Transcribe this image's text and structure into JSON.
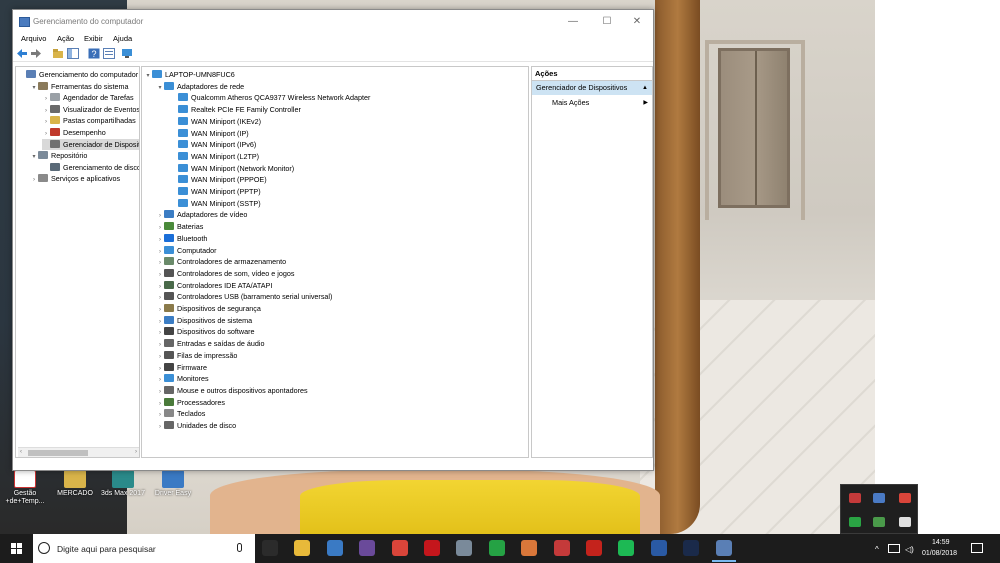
{
  "window": {
    "title": "Gerenciamento do computador",
    "controls": {
      "minimize": "—",
      "maximize": "☐",
      "close": "✕"
    }
  },
  "menu": [
    "Arquivo",
    "Ação",
    "Exibir",
    "Ajuda"
  ],
  "left_tree": [
    {
      "label": "Gerenciamento do computador",
      "level": 0,
      "expander": "",
      "icon_color": "#5a7fb5"
    },
    {
      "label": "Ferramentas do sistema",
      "level": 1,
      "expander": "▾",
      "icon_color": "#8a7a5a"
    },
    {
      "label": "Agendador de Tarefas",
      "level": 2,
      "expander": "›",
      "icon_color": "#9aa0a6"
    },
    {
      "label": "Visualizador de Eventos",
      "level": 2,
      "expander": "›",
      "icon_color": "#6a6a6a"
    },
    {
      "label": "Pastas compartilhadas",
      "level": 2,
      "expander": "›",
      "icon_color": "#d9b44a"
    },
    {
      "label": "Desempenho",
      "level": 2,
      "expander": "›",
      "icon_color": "#c0392b"
    },
    {
      "label": "Gerenciador de Disposit",
      "level": 2,
      "expander": "",
      "icon_color": "#707070",
      "selected": true
    },
    {
      "label": "Repositório",
      "level": 1,
      "expander": "▾",
      "icon_color": "#7b8a99"
    },
    {
      "label": "Gerenciamento de disco",
      "level": 2,
      "expander": "",
      "icon_color": "#5a6a78"
    },
    {
      "label": "Serviços e aplicativos",
      "level": 1,
      "expander": "›",
      "icon_color": "#8a8a8a"
    }
  ],
  "device_tree": {
    "root": "LAPTOP-UMN8FUC6",
    "expanded_category": "Adaptadores de rede",
    "network_adapters": [
      "Qualcomm Atheros QCA9377 Wireless Network Adapter",
      "Realtek PCIe FE Family Controller",
      "WAN Miniport (IKEv2)",
      "WAN Miniport (IP)",
      "WAN Miniport (IPv6)",
      "WAN Miniport (L2TP)",
      "WAN Miniport (Network Monitor)",
      "WAN Miniport (PPPOE)",
      "WAN Miniport (PPTP)",
      "WAN Miniport (SSTP)"
    ],
    "categories": [
      {
        "label": "Adaptadores de vídeo",
        "icon_color": "#3b7dc4"
      },
      {
        "label": "Baterias",
        "icon_color": "#4a8a3a"
      },
      {
        "label": "Bluetooth",
        "icon_color": "#1a6ed8"
      },
      {
        "label": "Computador",
        "icon_color": "#3b8fd6"
      },
      {
        "label": "Controladores de armazenamento",
        "icon_color": "#6a8a6a"
      },
      {
        "label": "Controladores de som, vídeo e jogos",
        "icon_color": "#555555"
      },
      {
        "label": "Controladores IDE ATA/ATAPI",
        "icon_color": "#4a6a4a"
      },
      {
        "label": "Controladores USB (barramento serial universal)",
        "icon_color": "#555555"
      },
      {
        "label": "Dispositivos de segurança",
        "icon_color": "#8a7a4a"
      },
      {
        "label": "Dispositivos de sistema",
        "icon_color": "#3b7dc4"
      },
      {
        "label": "Dispositivos do software",
        "icon_color": "#444444"
      },
      {
        "label": "Entradas e saídas de áudio",
        "icon_color": "#666666"
      },
      {
        "label": "Filas de impressão",
        "icon_color": "#555555"
      },
      {
        "label": "Firmware",
        "icon_color": "#444444"
      },
      {
        "label": "Monitores",
        "icon_color": "#3b8fd6"
      },
      {
        "label": "Mouse e outros dispositivos apontadores",
        "icon_color": "#666666"
      },
      {
        "label": "Processadores",
        "icon_color": "#4a7a3a"
      },
      {
        "label": "Teclados",
        "icon_color": "#888888"
      },
      {
        "label": "Unidades de disco",
        "icon_color": "#666666"
      }
    ]
  },
  "actions": {
    "header": "Ações",
    "selected": "Gerenciador de Dispositivos",
    "items": [
      "Mais Ações"
    ]
  },
  "desktop_icons": [
    {
      "label": "Gestão\n+de+Temp...",
      "color": "#ffffff"
    },
    {
      "label": "MERCADO",
      "color": "#d9b44a"
    },
    {
      "label": "3ds Max 2017",
      "color": "#2a8a8a"
    },
    {
      "label": "Driver Easy",
      "color": "#3a7ac4"
    }
  ],
  "taskbar": {
    "search_placeholder": "Digite aqui para pesquisar",
    "apps": [
      {
        "name": "task-view-icon",
        "color": "#2b2b2b"
      },
      {
        "name": "file-explorer-icon",
        "color": "#e8b93a"
      },
      {
        "name": "store-icon",
        "color": "#3a7ac4"
      },
      {
        "name": "media-app-icon",
        "color": "#6a4a9a"
      },
      {
        "name": "chrome-icon",
        "color": "#d9453a"
      },
      {
        "name": "netflix-icon",
        "color": "#c4161c"
      },
      {
        "name": "app-icon",
        "color": "#7a8a9a"
      },
      {
        "name": "whatsapp-icon",
        "color": "#25a244"
      },
      {
        "name": "instagram-icon",
        "color": "#d9773a"
      },
      {
        "name": "ruby-app-icon",
        "color": "#c43a3a"
      },
      {
        "name": "autocad-icon",
        "color": "#c4231c"
      },
      {
        "name": "spotify-icon",
        "color": "#1db954"
      },
      {
        "name": "revit-icon",
        "color": "#2a5aa4"
      },
      {
        "name": "photoshop-icon",
        "color": "#1a2a4a"
      },
      {
        "name": "computer-management-icon",
        "color": "#5a7fb5"
      }
    ],
    "time": "14:59",
    "date": "01/08/2018"
  }
}
